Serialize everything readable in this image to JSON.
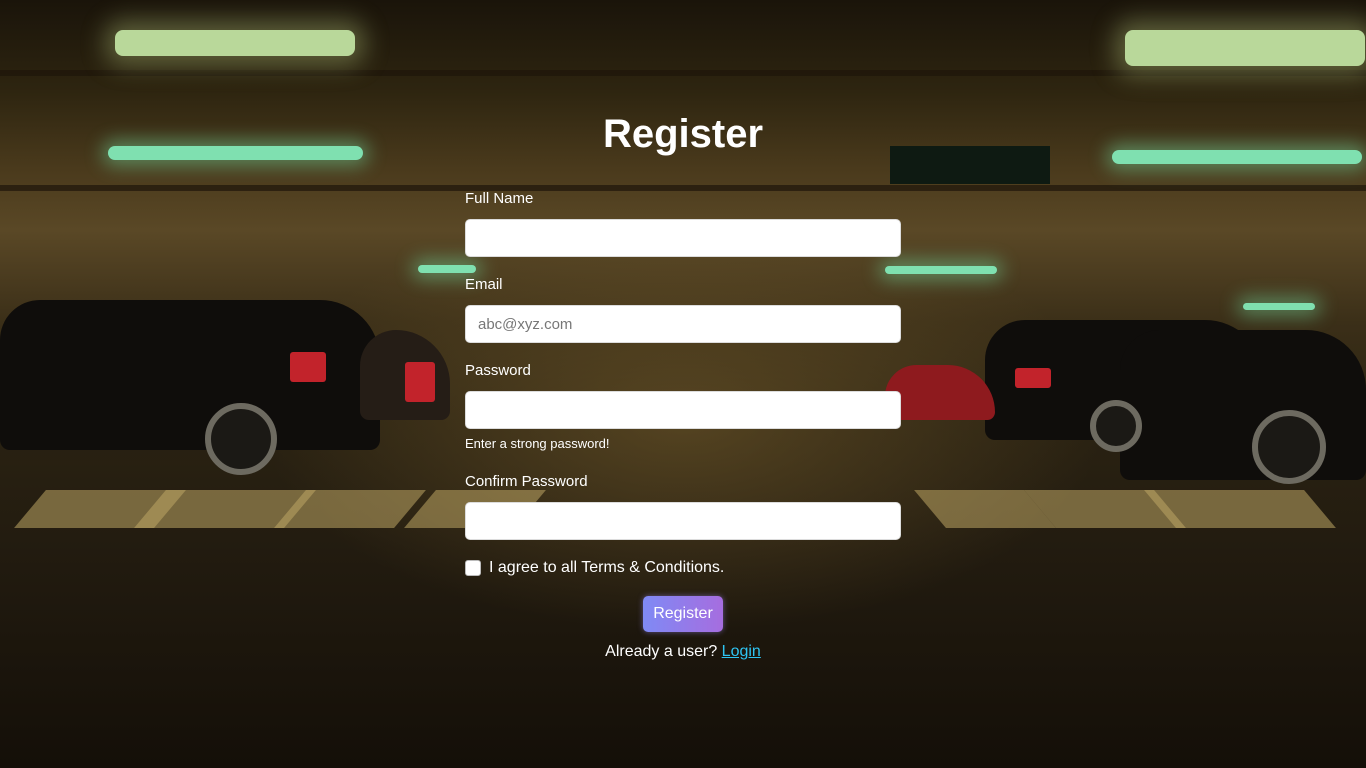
{
  "form": {
    "title": "Register",
    "full_name": {
      "label": "Full Name",
      "value": "",
      "placeholder": ""
    },
    "email": {
      "label": "Email",
      "value": "",
      "placeholder": "abc@xyz.com"
    },
    "password": {
      "label": "Password",
      "value": "",
      "placeholder": "",
      "hint": "Enter a strong password!"
    },
    "confirm_password": {
      "label": "Confirm Password",
      "value": "",
      "placeholder": ""
    },
    "terms": {
      "label": "I agree to all Terms & Conditions.",
      "checked": false
    },
    "submit_label": "Register",
    "login_prompt": "Already a user?",
    "login_link": "Login"
  },
  "colors": {
    "button_gradient_start": "#7f8af5",
    "button_gradient_end": "#a66ddf",
    "link": "#2ec4f2",
    "text": "#ffffff"
  },
  "background": {
    "scene": "parking garage photo"
  }
}
